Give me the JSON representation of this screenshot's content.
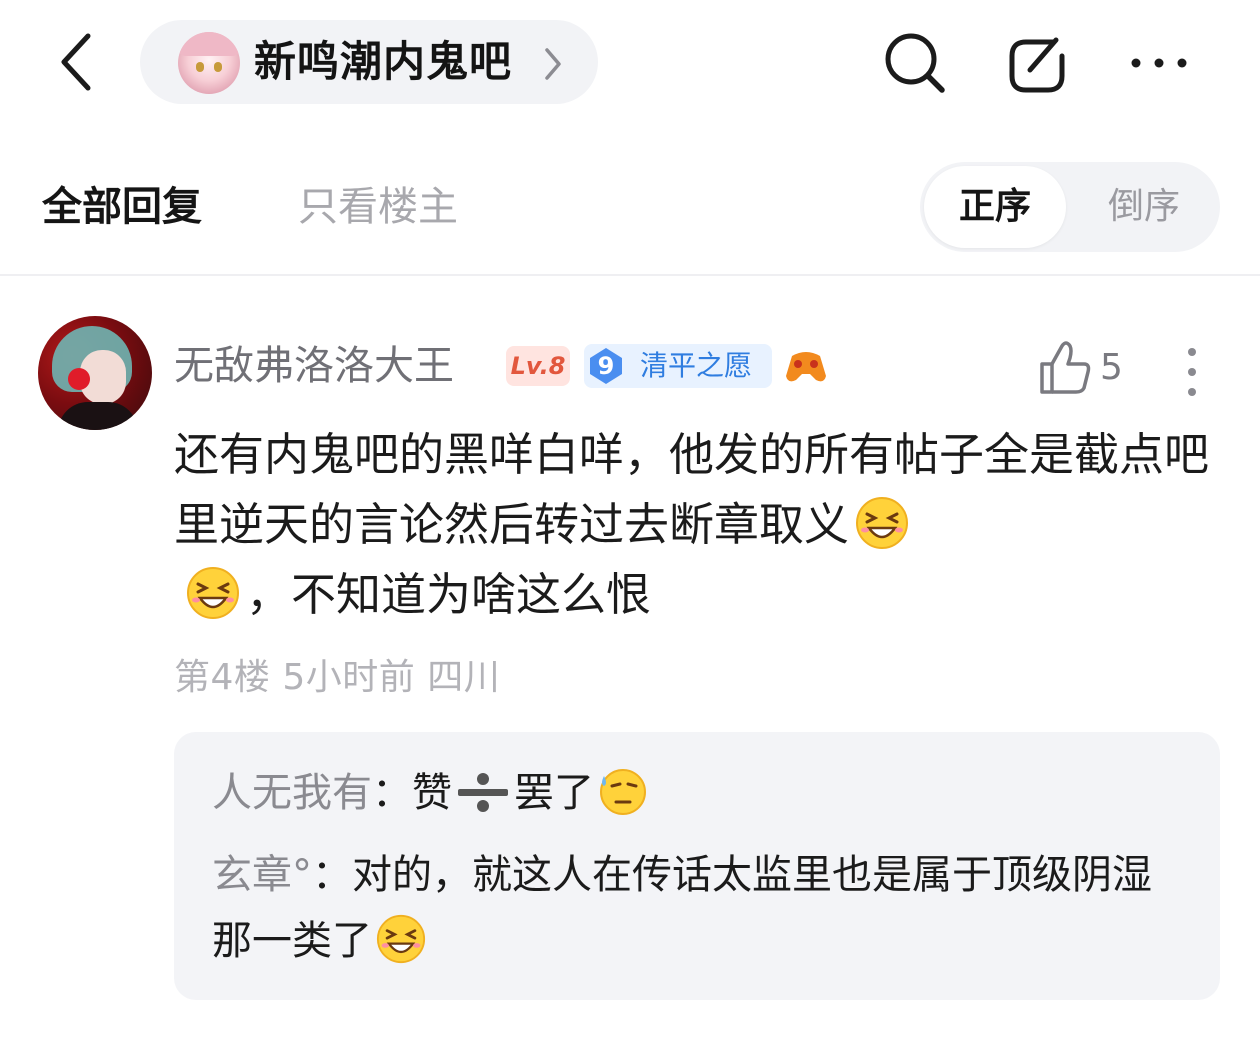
{
  "header": {
    "forum_name": "新鸣潮内鬼吧",
    "icons": [
      "back-arrow-icon",
      "search-icon",
      "edit-icon",
      "more-icon"
    ]
  },
  "tabs": {
    "all_replies": "全部回复",
    "owner_only": "只看楼主",
    "sort_asc": "正序",
    "sort_desc": "倒序",
    "selected_sort": "正序"
  },
  "post": {
    "username": "无敌弗洛洛大王",
    "level_badge": "Lv.8",
    "fan_level": "9",
    "fan_title": "清平之愿",
    "like_count": "5",
    "content_part1": "还有内鬼吧的黑咩白咩，他发的所有帖子全是截点吧里逆天的言论然后转过去断章取义",
    "content_part2": "，不知道为啥这么恨",
    "floor": "第4楼",
    "time": "5小时前",
    "location": "四川",
    "emojis": [
      "laugh-emoji",
      "sweat-emoji"
    ]
  },
  "sub_replies": [
    {
      "name": "人无我有",
      "separator": "：",
      "text_before": "赞",
      "text_after": "罢了"
    },
    {
      "name": "玄章°",
      "separator": "：",
      "text": "对的，就这人在传话太监里也是属于顶级阴湿那一类了"
    }
  ],
  "colors": {
    "accent_blue": "#2f7de0",
    "level_red": "#e2573d",
    "muted_text": "#b3b3b8",
    "box_bg": "#f3f4f7"
  }
}
